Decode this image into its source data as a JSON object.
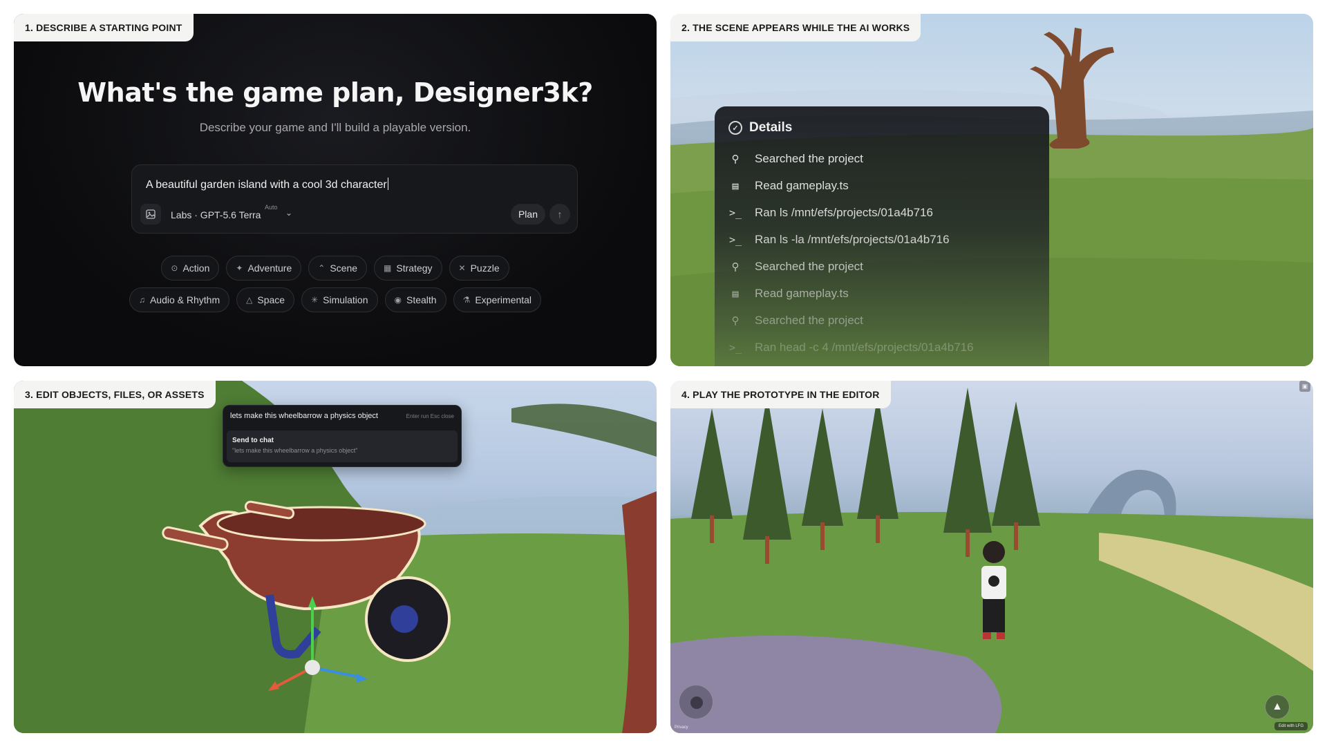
{
  "panels": {
    "p1": {
      "tag": "1. DESCRIBE A STARTING POINT",
      "title": "What's the game plan, Designer3k?",
      "subtitle": "Describe your game and I'll build a playable version.",
      "prompt_value": "A beautiful garden island with a cool 3d character",
      "model_label": "Labs · GPT-5.6 Terra",
      "model_badge": "Auto",
      "plan_label": "Plan",
      "chips_row1": [
        {
          "label": "Action",
          "icon": "target-icon"
        },
        {
          "label": "Adventure",
          "icon": "sparkle-icon"
        },
        {
          "label": "Scene",
          "icon": "mountain-icon"
        },
        {
          "label": "Strategy",
          "icon": "grid-icon"
        },
        {
          "label": "Puzzle",
          "icon": "cross-icon"
        }
      ],
      "chips_row2": [
        {
          "label": "Audio & Rhythm",
          "icon": "music-icon"
        },
        {
          "label": "Space",
          "icon": "rocket-icon"
        },
        {
          "label": "Simulation",
          "icon": "burst-icon"
        },
        {
          "label": "Stealth",
          "icon": "eye-icon"
        },
        {
          "label": "Experimental",
          "icon": "flask-icon"
        }
      ]
    },
    "p2": {
      "tag": "2. THE SCENE APPEARS WHILE THE AI WORKS",
      "details_title": "Details",
      "steps": [
        {
          "icon": "search-icon",
          "text": "Searched the project"
        },
        {
          "icon": "file-icon",
          "text": "Read gameplay.ts"
        },
        {
          "icon": "terminal-icon",
          "text": "Ran ls /mnt/efs/projects/01a4b716"
        },
        {
          "icon": "terminal-icon",
          "text": "Ran ls -la /mnt/efs/projects/01a4b716"
        },
        {
          "icon": "search-icon",
          "text": "Searched the project"
        },
        {
          "icon": "file-icon",
          "text": "Read gameplay.ts"
        },
        {
          "icon": "search-icon",
          "text": "Searched the project"
        },
        {
          "icon": "terminal-icon",
          "text": "Ran head -c 4 /mnt/efs/projects/01a4b716"
        }
      ]
    },
    "p3": {
      "tag": "3. EDIT OBJECTS, FILES, OR ASSETS",
      "chat_query": "lets make this wheelbarrow a physics object",
      "chat_hint": "Enter run  Esc close",
      "send_title": "Send to chat",
      "send_sub": "\"lets make this wheelbarrow a physics object\""
    },
    "p4": {
      "tag": "4. PLAY THE PROTOTYPE IN THE EDITOR",
      "privacy": "Privacy",
      "edit_with": "Edit with LFG"
    }
  }
}
